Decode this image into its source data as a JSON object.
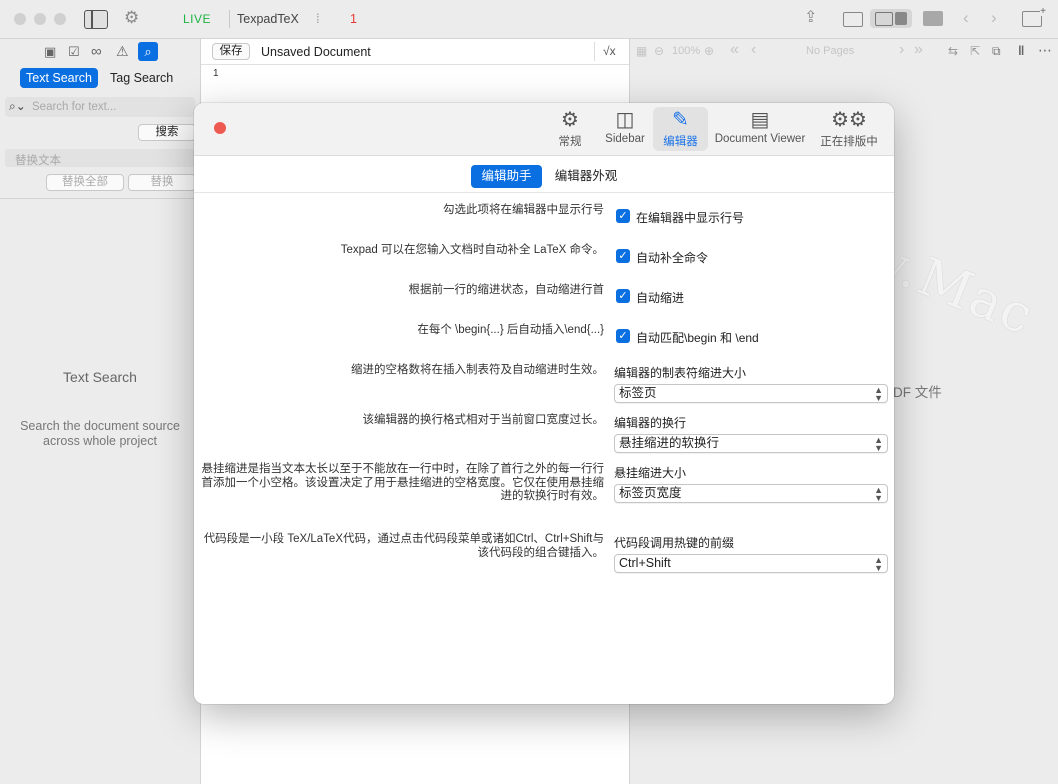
{
  "topbar": {
    "live": "LIVE",
    "app_title": "TexpadTeX",
    "error_count": "1",
    "accent": "#1fb343",
    "error_color": "#e53935"
  },
  "left": {
    "tabs": [
      "Text Search",
      "Tag Search"
    ],
    "search_placeholder": "Search for text...",
    "search_button": "搜索",
    "replace_placeholder": "替换文本",
    "replace_all": "替换全部",
    "replace": "替换",
    "empty_title": "Text Search",
    "empty_desc": "Search the document source across whole project"
  },
  "editor": {
    "save": "保存",
    "doc_title": "Unsaved Document",
    "sqrt_icon": "√x",
    "line_number": "1"
  },
  "viewer": {
    "zoom": "100%",
    "pages": "No Pages",
    "pdf_hint": "DF 文件"
  },
  "watermark": "www.Mac",
  "settings": {
    "toolbar": [
      {
        "label": "常规",
        "icon": "gear-icon"
      },
      {
        "label": "Sidebar",
        "icon": "sidebar-icon"
      },
      {
        "label": "编辑器",
        "icon": "pencil-icon"
      },
      {
        "label": "Document Viewer",
        "icon": "document-icon"
      },
      {
        "label": "正在排版中",
        "icon": "gears-icon"
      }
    ],
    "tabs": [
      "编辑助手",
      "编辑器外观"
    ],
    "rows": [
      {
        "desc": "勾选此项将在编辑器中显示行号",
        "checkbox": "在编辑器中显示行号"
      },
      {
        "desc": "Texpad 可以在您输入文档时自动补全 LaTeX 命令。",
        "checkbox": "自动补全命令"
      },
      {
        "desc": "根据前一行的缩进状态，自动缩进行首",
        "checkbox": "自动缩进"
      },
      {
        "desc": "在每个 \\begin{...} 后自动插入\\end{...}",
        "checkbox": "自动匹配\\begin 和 \\end"
      }
    ],
    "selects": [
      {
        "desc": "缩进的空格数将在插入制表符及自动缩进时生效。",
        "label": "编辑器的制表符缩进大小",
        "value": "标签页"
      },
      {
        "desc": "该编辑器的换行格式相对于当前窗口宽度过长。",
        "label": "编辑器的换行",
        "value": "悬挂缩进的软换行"
      },
      {
        "desc_lines": [
          "悬挂缩进是指当文本太长以至于不能放在一行中时，在除了首行之外的每一行行",
          "首添加一个小空格。该设置决定了用于悬挂缩进的空格宽度。它仅在使用悬挂缩",
          "进的软换行时有效。"
        ],
        "label": "悬挂缩进大小",
        "value": "标签页宽度"
      },
      {
        "desc_lines": [
          "代码段是一小段 TeX/LaTeX代码，通过点击代码段菜单或诸如Ctrl、Ctrl+Shift与",
          "该代码段的组合键插入。"
        ],
        "label": "代码段调用热键的前缀",
        "value": "Ctrl+Shift"
      }
    ],
    "close_color": "#ee5a52",
    "accent": "#1a73e8"
  }
}
